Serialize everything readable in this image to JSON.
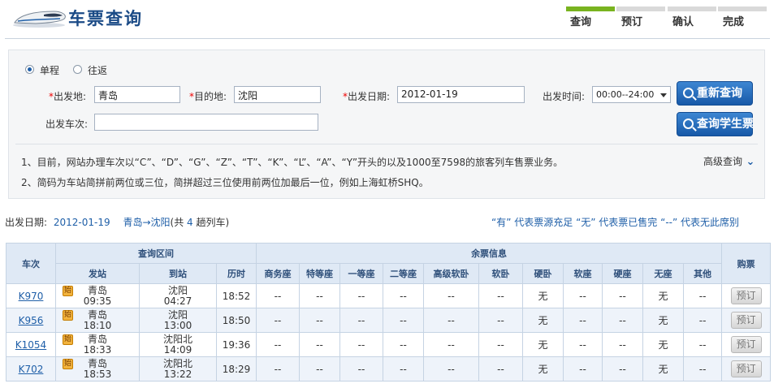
{
  "header": {
    "title": "车票查询",
    "steps": [
      "查询",
      "预订",
      "确认",
      "完成"
    ],
    "active_step": 0,
    "colors": {
      "title": "#1a4a86",
      "active_step": "#79b31f",
      "inactive_step": "#d9d9d9"
    }
  },
  "query": {
    "trip_type": {
      "one_way": "单程",
      "round_trip": "往返",
      "selected": "单程"
    },
    "from": {
      "label": "出发地:",
      "value": "青岛"
    },
    "to": {
      "label": "目的地:",
      "value": "沈阳"
    },
    "date": {
      "label": "出发日期:",
      "value": "2012-01-19"
    },
    "time": {
      "label": "出发时间:",
      "value": "00:00--24:00"
    },
    "train_no": {
      "label": "出发车次:",
      "value": ""
    },
    "required_mark": "*",
    "btn_requery": "重新查询",
    "btn_student": "查询学生票",
    "advanced": "高级查询",
    "notes": [
      "1、目前，网站办理车次以“C”、“D”、“G”、“Z”、“T”、“K”、“L”、“A”、“Y”开头的以及1000至7598的旅客列车售票业务。",
      "2、简码为车站简拼前两位或三位，简拼超过三位使用前两位加最后一位，例如上海虹桥SHQ。"
    ]
  },
  "summary": {
    "date_label": "出发日期:",
    "date": "2012-01-19",
    "route": "青岛→沈阳",
    "count_prefix": "(共",
    "count": "4",
    "count_suffix": "趟列车)",
    "legend": "“有” 代表票源充足  “无” 代表票已售完  “--” 代表无此席别"
  },
  "table": {
    "h_train": "车次",
    "h_interval": "查询区间",
    "h_seats": "余票信息",
    "h_book": "购票",
    "h_sub": [
      "发站",
      "到站",
      "历时"
    ],
    "seat_types": [
      "商务座",
      "特等座",
      "一等座",
      "二等座",
      "高级软卧",
      "软卧",
      "硬卧",
      "软座",
      "硬座",
      "无座",
      "其他"
    ],
    "rows": [
      {
        "train": "K970",
        "badge": "始",
        "from": "青岛",
        "dep": "09:35",
        "to": "沈阳",
        "arr": "04:27",
        "dur": "18:52",
        "seats": [
          "--",
          "--",
          "--",
          "--",
          "--",
          "--",
          "无",
          "--",
          "--",
          "无",
          "--"
        ],
        "book": "预订"
      },
      {
        "train": "K956",
        "badge": "始",
        "from": "青岛",
        "dep": "18:10",
        "to": "沈阳",
        "arr": "13:00",
        "dur": "18:50",
        "seats": [
          "--",
          "--",
          "--",
          "--",
          "--",
          "--",
          "无",
          "--",
          "--",
          "无",
          "--"
        ],
        "book": "预订"
      },
      {
        "train": "K1054",
        "badge": "始",
        "from": "青岛",
        "dep": "18:33",
        "to": "沈阳北",
        "arr": "14:09",
        "dur": "19:36",
        "seats": [
          "--",
          "--",
          "--",
          "--",
          "--",
          "--",
          "无",
          "--",
          "--",
          "无",
          "--"
        ],
        "book": "预订"
      },
      {
        "train": "K702",
        "badge": "始",
        "from": "青岛",
        "dep": "18:53",
        "to": "沈阳北",
        "arr": "13:22",
        "dur": "18:29",
        "seats": [
          "--",
          "--",
          "--",
          "--",
          "--",
          "--",
          "无",
          "--",
          "--",
          "无",
          "--"
        ],
        "book": "预订"
      }
    ]
  }
}
